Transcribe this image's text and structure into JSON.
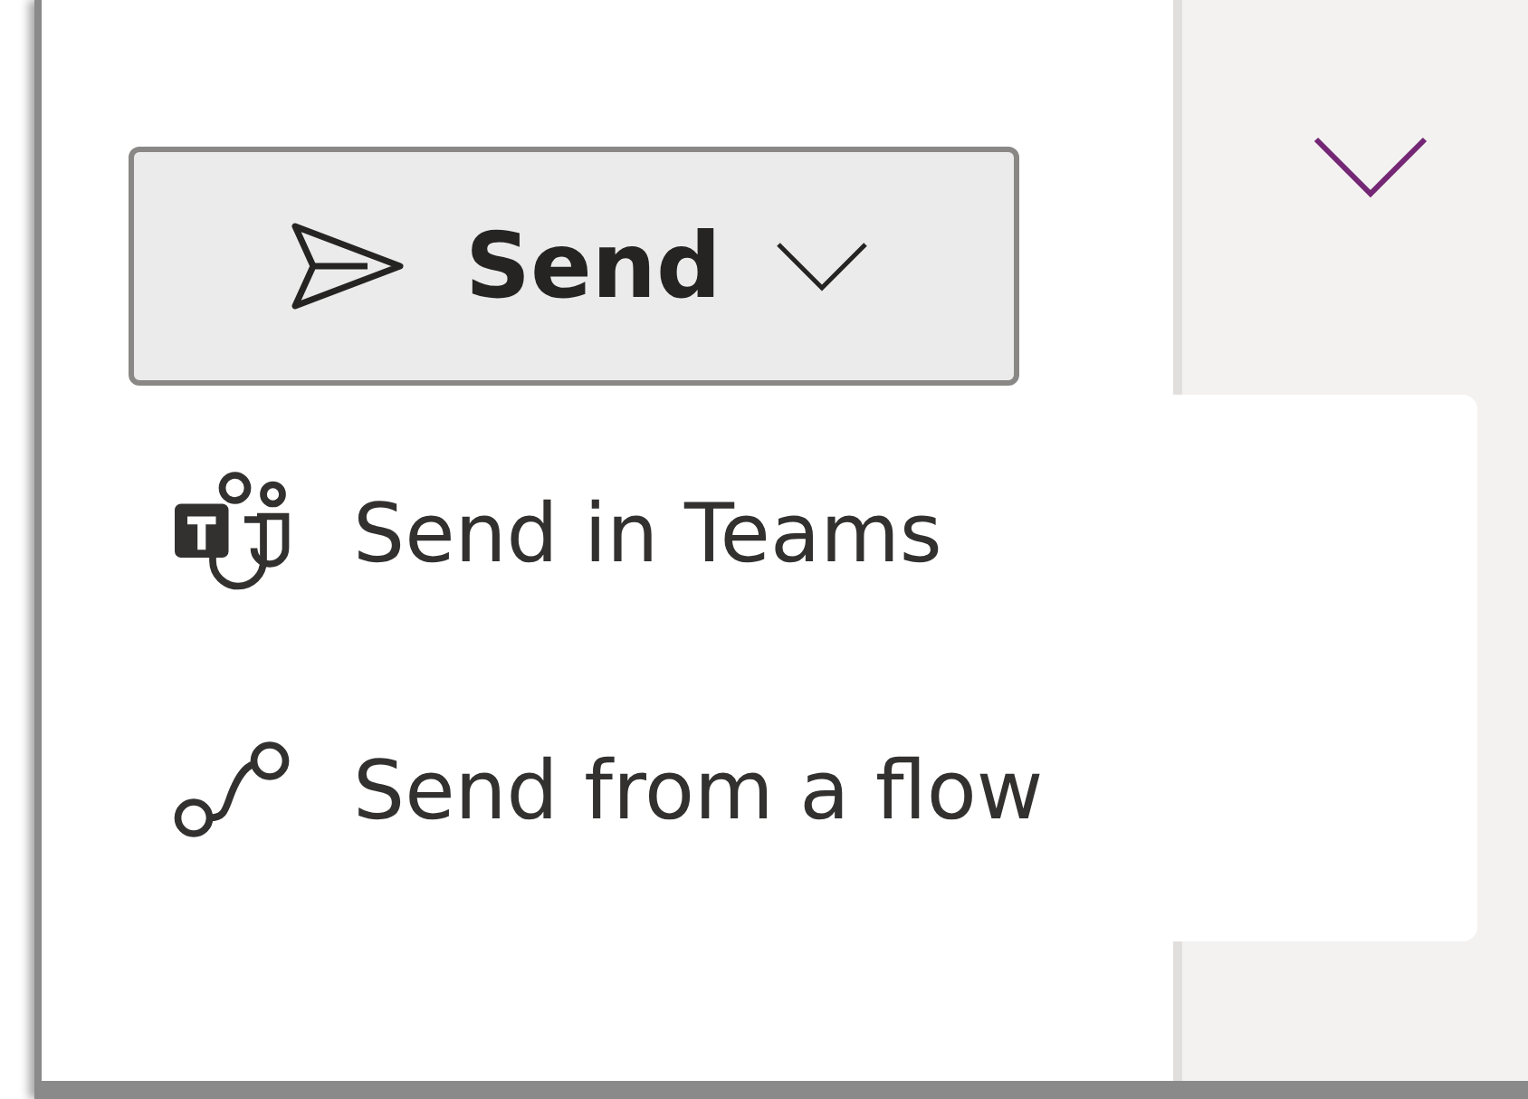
{
  "send_button": {
    "label": "Send"
  },
  "menu": {
    "items": [
      {
        "label": "Send in Teams",
        "kind": "teams"
      },
      {
        "label": "Send from a flow",
        "kind": "flow"
      }
    ]
  }
}
